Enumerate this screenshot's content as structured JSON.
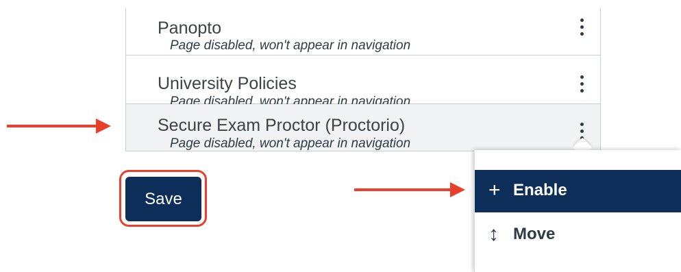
{
  "nav_items": [
    {
      "title": "Panopto",
      "status": "Page disabled, won't appear in navigation"
    },
    {
      "title": "University Policies",
      "status": "Page disabled, won't appear in navigation"
    },
    {
      "title": "Secure Exam Proctor (Proctorio)",
      "status": "Page disabled, won't appear in navigation"
    }
  ],
  "save_label": "Save",
  "menu": {
    "enable": {
      "icon": "+",
      "label": "Enable"
    },
    "move": {
      "icon": "↕",
      "label": "Move"
    }
  },
  "colors": {
    "accent": "#0c2e58",
    "highlight": "#e8402d",
    "selected_row": "#f2f3f4"
  }
}
